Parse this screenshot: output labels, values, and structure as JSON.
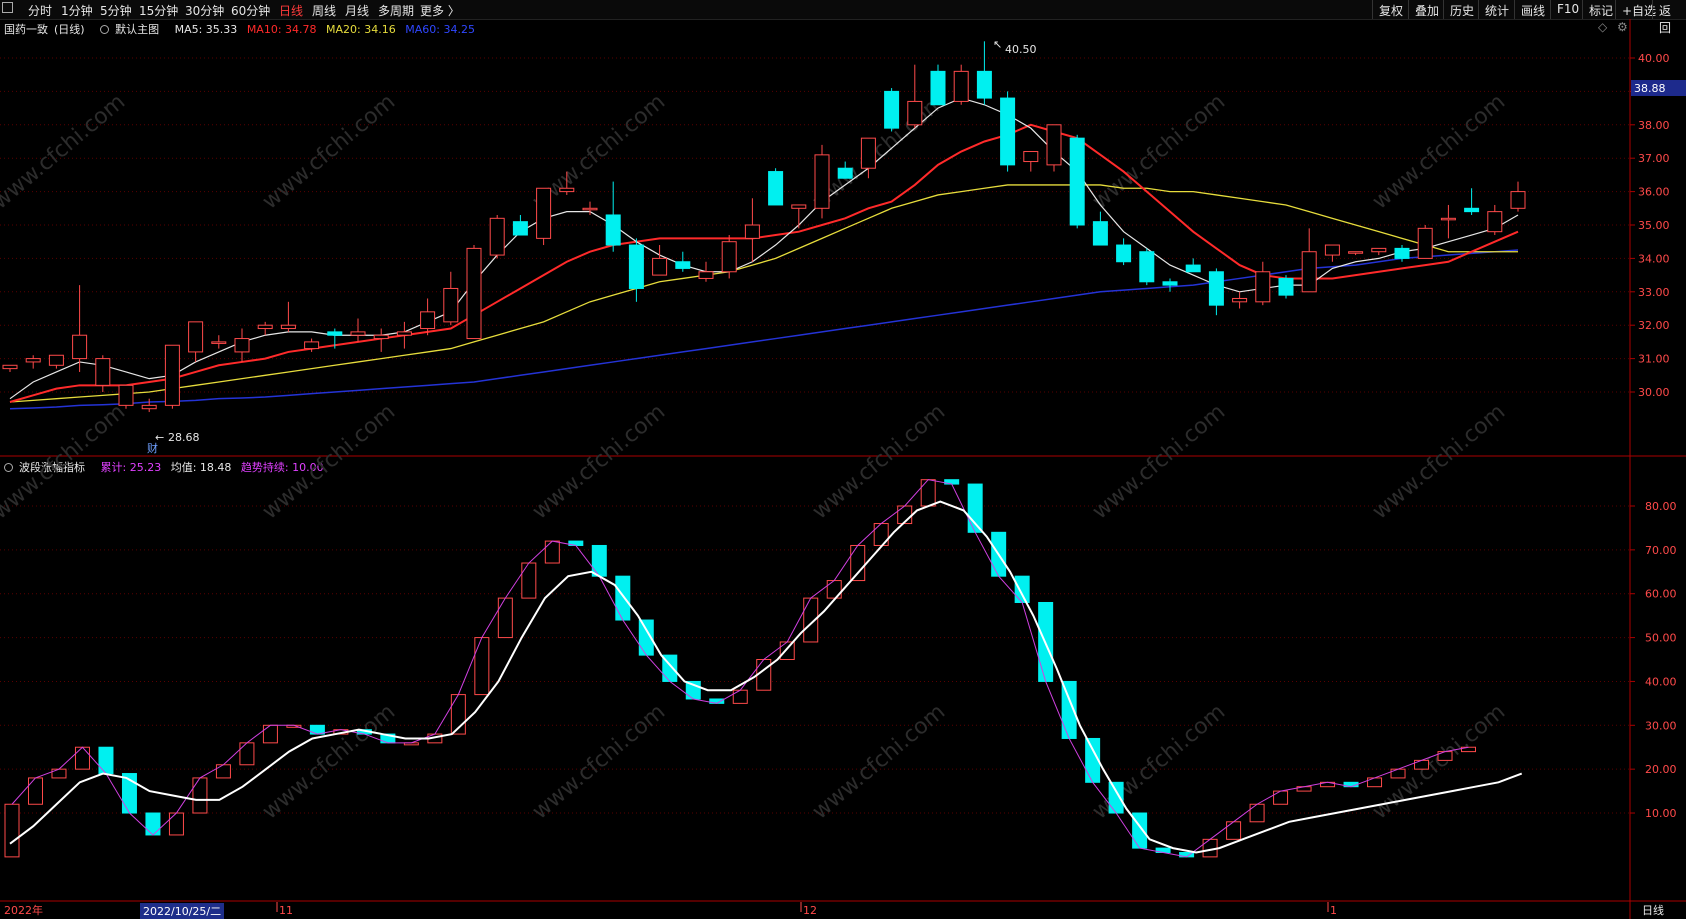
{
  "toolbar": {
    "left_items": [
      "分时",
      "1分钟",
      "5分钟",
      "15分钟",
      "30分钟",
      "60分钟",
      "日线",
      "周线",
      "月线",
      "多周期",
      "更多 〉"
    ],
    "active": "日线",
    "right_items": [
      "复权",
      "叠加",
      "历史",
      "统计",
      "画线",
      "F10",
      "标记",
      "+自选",
      "返回"
    ]
  },
  "main_chart": {
    "stock": "国药一致",
    "period": "(日线)",
    "template": "默认主图",
    "ma5_label": "MA5: 35.33",
    "ma10_label": "MA10: 34.78",
    "ma20_label": "MA20: 34.16",
    "ma60_label": "MA60: 34.25",
    "high_label": "40.50",
    "low_label": "28.68",
    "cai_label": "财",
    "current_price_tag": "38.88",
    "price_ticks": [
      "40.00",
      "39.00",
      "38.00",
      "37.00",
      "36.00",
      "35.00",
      "34.00",
      "33.00",
      "32.00",
      "31.00",
      "30.00"
    ],
    "colors": {
      "ma5": "#e6e6e6",
      "ma10": "#ff2a2a",
      "ma20": "#e6dc3c",
      "ma60": "#2433d6",
      "up": "#ff4a4a",
      "down": "#00f0f0"
    }
  },
  "indicator": {
    "name": "波段涨幅指标",
    "sum_label": "累计: 25.23",
    "avg_label": "均值: 18.48",
    "trend_label": "趋势持续: 10.00",
    "ticks": [
      "80.00",
      "70.00",
      "60.00",
      "50.00",
      "40.00",
      "30.00",
      "20.00",
      "10.00"
    ]
  },
  "time_axis": {
    "year": "2022年",
    "cursor_date": "2022/10/25/二",
    "month_labels": [
      "11",
      "12",
      "1"
    ],
    "period_label": "日线"
  },
  "watermark": "www.cfchi.com",
  "chart_data": [
    {
      "type": "candlestick",
      "title": "国药一致 (日线)",
      "ylim": [
        29.0,
        40.6
      ],
      "ohlc": [
        [
          30.7,
          30.8,
          30.6,
          30.8
        ],
        [
          30.9,
          31.1,
          30.7,
          31.0
        ],
        [
          30.8,
          31.1,
          30.7,
          31.1
        ],
        [
          31.0,
          33.2,
          30.6,
          31.7
        ],
        [
          30.2,
          31.1,
          30.0,
          31.0
        ],
        [
          29.6,
          30.2,
          29.5,
          30.2
        ],
        [
          29.5,
          29.8,
          29.4,
          29.6
        ],
        [
          29.6,
          31.4,
          29.5,
          31.4
        ],
        [
          31.2,
          32.0,
          30.9,
          32.1
        ],
        [
          31.5,
          31.7,
          31.3,
          31.5
        ],
        [
          31.2,
          31.9,
          30.9,
          31.6
        ],
        [
          31.9,
          32.1,
          31.7,
          32.0
        ],
        [
          31.9,
          32.7,
          31.8,
          32.0
        ],
        [
          31.3,
          31.6,
          31.2,
          31.5
        ],
        [
          31.8,
          31.9,
          31.3,
          31.7
        ],
        [
          31.7,
          32.2,
          31.5,
          31.8
        ],
        [
          31.6,
          31.9,
          31.2,
          31.7
        ],
        [
          31.7,
          32.1,
          31.3,
          31.8
        ],
        [
          31.9,
          32.8,
          31.7,
          32.4
        ],
        [
          32.1,
          33.6,
          32.0,
          33.1
        ],
        [
          31.6,
          34.4,
          31.6,
          34.3
        ],
        [
          34.1,
          35.3,
          34.0,
          35.2
        ],
        [
          35.1,
          35.3,
          34.7,
          34.7
        ],
        [
          34.6,
          36.1,
          34.4,
          36.1
        ],
        [
          36.0,
          36.6,
          35.9,
          36.1
        ],
        [
          35.5,
          35.7,
          35.3,
          35.5
        ],
        [
          35.3,
          36.3,
          34.2,
          34.4
        ],
        [
          34.4,
          34.6,
          32.7,
          33.1
        ],
        [
          33.5,
          34.4,
          33.5,
          34.0
        ],
        [
          33.9,
          34.2,
          33.6,
          33.7
        ],
        [
          33.4,
          33.9,
          33.3,
          33.6
        ],
        [
          33.6,
          34.7,
          33.4,
          34.5
        ],
        [
          34.6,
          35.8,
          33.9,
          35.0
        ],
        [
          36.6,
          36.7,
          35.6,
          35.6
        ],
        [
          35.5,
          35.6,
          34.9,
          35.6
        ],
        [
          35.5,
          37.4,
          35.2,
          37.1
        ],
        [
          36.7,
          36.9,
          36.4,
          36.4
        ],
        [
          36.7,
          37.5,
          36.4,
          37.6
        ],
        [
          39.0,
          39.1,
          37.8,
          37.9
        ],
        [
          38.0,
          39.8,
          37.9,
          38.7
        ],
        [
          39.6,
          39.8,
          38.6,
          38.6
        ],
        [
          38.7,
          39.8,
          38.6,
          39.6
        ],
        [
          39.6,
          40.5,
          38.6,
          38.8
        ],
        [
          38.8,
          39.0,
          36.6,
          36.8
        ],
        [
          36.9,
          37.1,
          36.6,
          37.2
        ],
        [
          36.8,
          38.0,
          36.6,
          38.0
        ],
        [
          37.6,
          37.7,
          34.9,
          35.0
        ],
        [
          35.1,
          35.4,
          34.4,
          34.4
        ],
        [
          34.4,
          34.6,
          33.8,
          33.9
        ],
        [
          34.2,
          34.3,
          33.2,
          33.3
        ],
        [
          33.3,
          33.4,
          33.0,
          33.2
        ],
        [
          33.8,
          34.0,
          33.6,
          33.6
        ],
        [
          33.6,
          33.7,
          32.3,
          32.6
        ],
        [
          32.7,
          33.0,
          32.5,
          32.8
        ],
        [
          32.7,
          33.9,
          32.6,
          33.6
        ],
        [
          33.4,
          33.5,
          32.8,
          32.9
        ],
        [
          33.0,
          34.9,
          33.0,
          34.2
        ],
        [
          34.1,
          34.4,
          33.9,
          34.4
        ],
        [
          34.2,
          34.2,
          34.1,
          34.2
        ],
        [
          34.2,
          34.3,
          34.1,
          34.3
        ],
        [
          34.3,
          34.4,
          33.9,
          34.0
        ],
        [
          34.0,
          35.0,
          34.0,
          34.9
        ],
        [
          35.2,
          35.6,
          34.6,
          35.2
        ],
        [
          35.5,
          36.1,
          35.3,
          35.4
        ],
        [
          34.8,
          35.6,
          34.7,
          35.4
        ],
        [
          35.5,
          36.3,
          35.4,
          36.0
        ]
      ],
      "ma5": [
        29.8,
        30.3,
        30.6,
        30.9,
        30.8,
        30.6,
        30.4,
        30.5,
        30.9,
        31.2,
        31.5,
        31.7,
        31.8,
        31.8,
        31.7,
        31.7,
        31.7,
        31.8,
        32.1,
        32.4,
        33.3,
        34.1,
        34.8,
        35.2,
        35.4,
        35.4,
        35.0,
        34.5,
        34.1,
        33.8,
        33.6,
        33.6,
        33.9,
        34.4,
        35.0,
        35.7,
        36.2,
        36.7,
        37.3,
        37.9,
        38.5,
        38.8,
        38.6,
        38.3,
        37.9,
        37.2,
        36.6,
        35.6,
        34.8,
        34.3,
        33.8,
        33.5,
        33.2,
        33.0,
        33.1,
        33.2,
        33.2,
        33.7,
        33.9,
        34.0,
        34.2,
        34.3,
        34.5,
        34.7,
        34.9,
        35.3
      ],
      "ma10": [
        29.7,
        29.9,
        30.1,
        30.2,
        30.2,
        30.2,
        30.3,
        30.4,
        30.6,
        30.8,
        30.9,
        31.0,
        31.2,
        31.3,
        31.4,
        31.5,
        31.6,
        31.7,
        31.8,
        31.9,
        32.3,
        32.7,
        33.1,
        33.5,
        33.9,
        34.2,
        34.4,
        34.5,
        34.6,
        34.6,
        34.6,
        34.6,
        34.6,
        34.7,
        34.8,
        35.0,
        35.2,
        35.5,
        35.7,
        36.2,
        36.8,
        37.2,
        37.5,
        37.7,
        38.0,
        37.8,
        37.6,
        37.1,
        36.6,
        36.0,
        35.4,
        34.8,
        34.3,
        33.8,
        33.5,
        33.4,
        33.4,
        33.4,
        33.5,
        33.6,
        33.7,
        33.8,
        33.9,
        34.2,
        34.5,
        34.8
      ],
      "ma20": [
        29.7,
        29.75,
        29.8,
        29.85,
        29.9,
        29.95,
        30.0,
        30.1,
        30.2,
        30.3,
        30.4,
        30.5,
        30.6,
        30.7,
        30.8,
        30.9,
        31.0,
        31.1,
        31.2,
        31.3,
        31.5,
        31.7,
        31.9,
        32.1,
        32.4,
        32.7,
        32.9,
        33.1,
        33.3,
        33.4,
        33.5,
        33.6,
        33.8,
        34.0,
        34.3,
        34.6,
        34.9,
        35.2,
        35.5,
        35.7,
        35.9,
        36.0,
        36.1,
        36.2,
        36.2,
        36.2,
        36.2,
        36.2,
        36.1,
        36.1,
        36.0,
        36.0,
        35.9,
        35.8,
        35.7,
        35.6,
        35.4,
        35.2,
        35.0,
        34.8,
        34.6,
        34.4,
        34.2,
        34.2,
        34.2,
        34.2
      ],
      "ma60": [
        29.5,
        29.52,
        29.55,
        29.6,
        29.62,
        29.65,
        29.7,
        29.72,
        29.75,
        29.8,
        29.82,
        29.85,
        29.9,
        29.95,
        30.0,
        30.05,
        30.1,
        30.15,
        30.2,
        30.25,
        30.3,
        30.4,
        30.5,
        30.6,
        30.7,
        30.8,
        30.9,
        31.0,
        31.1,
        31.2,
        31.3,
        31.4,
        31.5,
        31.6,
        31.7,
        31.8,
        31.9,
        32.0,
        32.1,
        32.2,
        32.3,
        32.4,
        32.5,
        32.6,
        32.7,
        32.8,
        32.9,
        33.0,
        33.05,
        33.1,
        33.15,
        33.2,
        33.3,
        33.4,
        33.5,
        33.6,
        33.7,
        33.75,
        33.8,
        33.9,
        34.0,
        34.05,
        34.1,
        34.15,
        34.2,
        34.25
      ]
    },
    {
      "type": "bar",
      "title": "波段涨幅指标",
      "ylim": [
        0,
        88
      ],
      "bars": [
        [
          0,
          12
        ],
        [
          12,
          18
        ],
        [
          18,
          20
        ],
        [
          20,
          25
        ],
        [
          25,
          19
        ],
        [
          19,
          10
        ],
        [
          10,
          5
        ],
        [
          5,
          10
        ],
        [
          10,
          18
        ],
        [
          18,
          21
        ],
        [
          21,
          26
        ],
        [
          26,
          30
        ],
        [
          30,
          30
        ],
        [
          30,
          28
        ],
        [
          28,
          29
        ],
        [
          29,
          28
        ],
        [
          28,
          26
        ],
        [
          26,
          26
        ],
        [
          26,
          28
        ],
        [
          28,
          37
        ],
        [
          37,
          50
        ],
        [
          50,
          59
        ],
        [
          59,
          67
        ],
        [
          67,
          72
        ],
        [
          72,
          71
        ],
        [
          71,
          64
        ],
        [
          64,
          54
        ],
        [
          54,
          46
        ],
        [
          46,
          40
        ],
        [
          40,
          36
        ],
        [
          36,
          35
        ],
        [
          35,
          38
        ],
        [
          38,
          45
        ],
        [
          45,
          49
        ],
        [
          49,
          59
        ],
        [
          59,
          63
        ],
        [
          63,
          71
        ],
        [
          71,
          76
        ],
        [
          76,
          80
        ],
        [
          80,
          86
        ],
        [
          86,
          85
        ],
        [
          85,
          74
        ],
        [
          74,
          64
        ],
        [
          64,
          58
        ],
        [
          58,
          40
        ],
        [
          40,
          27
        ],
        [
          27,
          17
        ],
        [
          17,
          10
        ],
        [
          10,
          2
        ],
        [
          2,
          1
        ],
        [
          1,
          0
        ],
        [
          0,
          4
        ],
        [
          4,
          8
        ],
        [
          8,
          12
        ],
        [
          12,
          15
        ],
        [
          15,
          16
        ],
        [
          16,
          17
        ],
        [
          17,
          16
        ],
        [
          16,
          18
        ],
        [
          18,
          20
        ],
        [
          20,
          22
        ],
        [
          22,
          24
        ],
        [
          24,
          25
        ]
      ],
      "trend_line": [
        3,
        7,
        12,
        17,
        19,
        18,
        15,
        14,
        13,
        13,
        16,
        20,
        24,
        27,
        28,
        29,
        28,
        27,
        27,
        28,
        33,
        40,
        50,
        59,
        64,
        65,
        62,
        55,
        46,
        40,
        38,
        38,
        41,
        45,
        51,
        56,
        62,
        68,
        74,
        79,
        81,
        79,
        73,
        65,
        55,
        43,
        30,
        20,
        11,
        4,
        2,
        1,
        2,
        4,
        6,
        8,
        9,
        10,
        11,
        12,
        13,
        14,
        15,
        16,
        17,
        19
      ]
    }
  ]
}
